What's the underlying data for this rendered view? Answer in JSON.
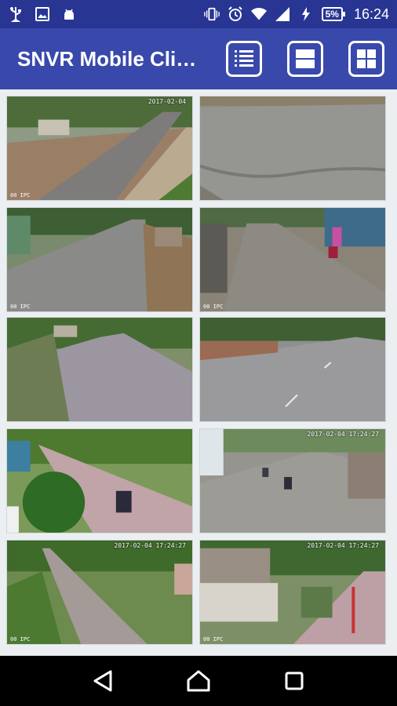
{
  "status": {
    "battery": "5%",
    "time": "16:24",
    "left_icons": [
      "usb-icon",
      "image-icon",
      "android-icon"
    ],
    "right_icons": [
      "vibrate-icon",
      "alarm-icon",
      "wifi-icon",
      "signal-icon",
      "charging-icon"
    ]
  },
  "appbar": {
    "title": "SNVR Mobile Cli…",
    "buttons": [
      "list-view-button",
      "two-row-layout-button",
      "four-grid-layout-button"
    ]
  },
  "cameras": [
    {
      "timestamp": "2017-02-04",
      "label": "00 IPC"
    },
    {
      "timestamp": "",
      "label": ""
    },
    {
      "timestamp": "",
      "label": "00 IPC"
    },
    {
      "timestamp": "",
      "label": "00 IPC"
    },
    {
      "timestamp": "",
      "label": ""
    },
    {
      "timestamp": "",
      "label": ""
    },
    {
      "timestamp": "",
      "label": ""
    },
    {
      "timestamp": "2017-02-04 17:24:27",
      "label": ""
    },
    {
      "timestamp": "2017-02-04 17:24:27",
      "label": "00 IPC"
    },
    {
      "timestamp": "2017-02-04 17:24:27",
      "label": "00 IPC"
    }
  ],
  "colors": {
    "statusbar": "#283593",
    "appbar": "#3949ab",
    "background": "#eceff1",
    "navbar": "#000000"
  },
  "navbar": [
    "back-button",
    "home-button",
    "recents-button"
  ]
}
